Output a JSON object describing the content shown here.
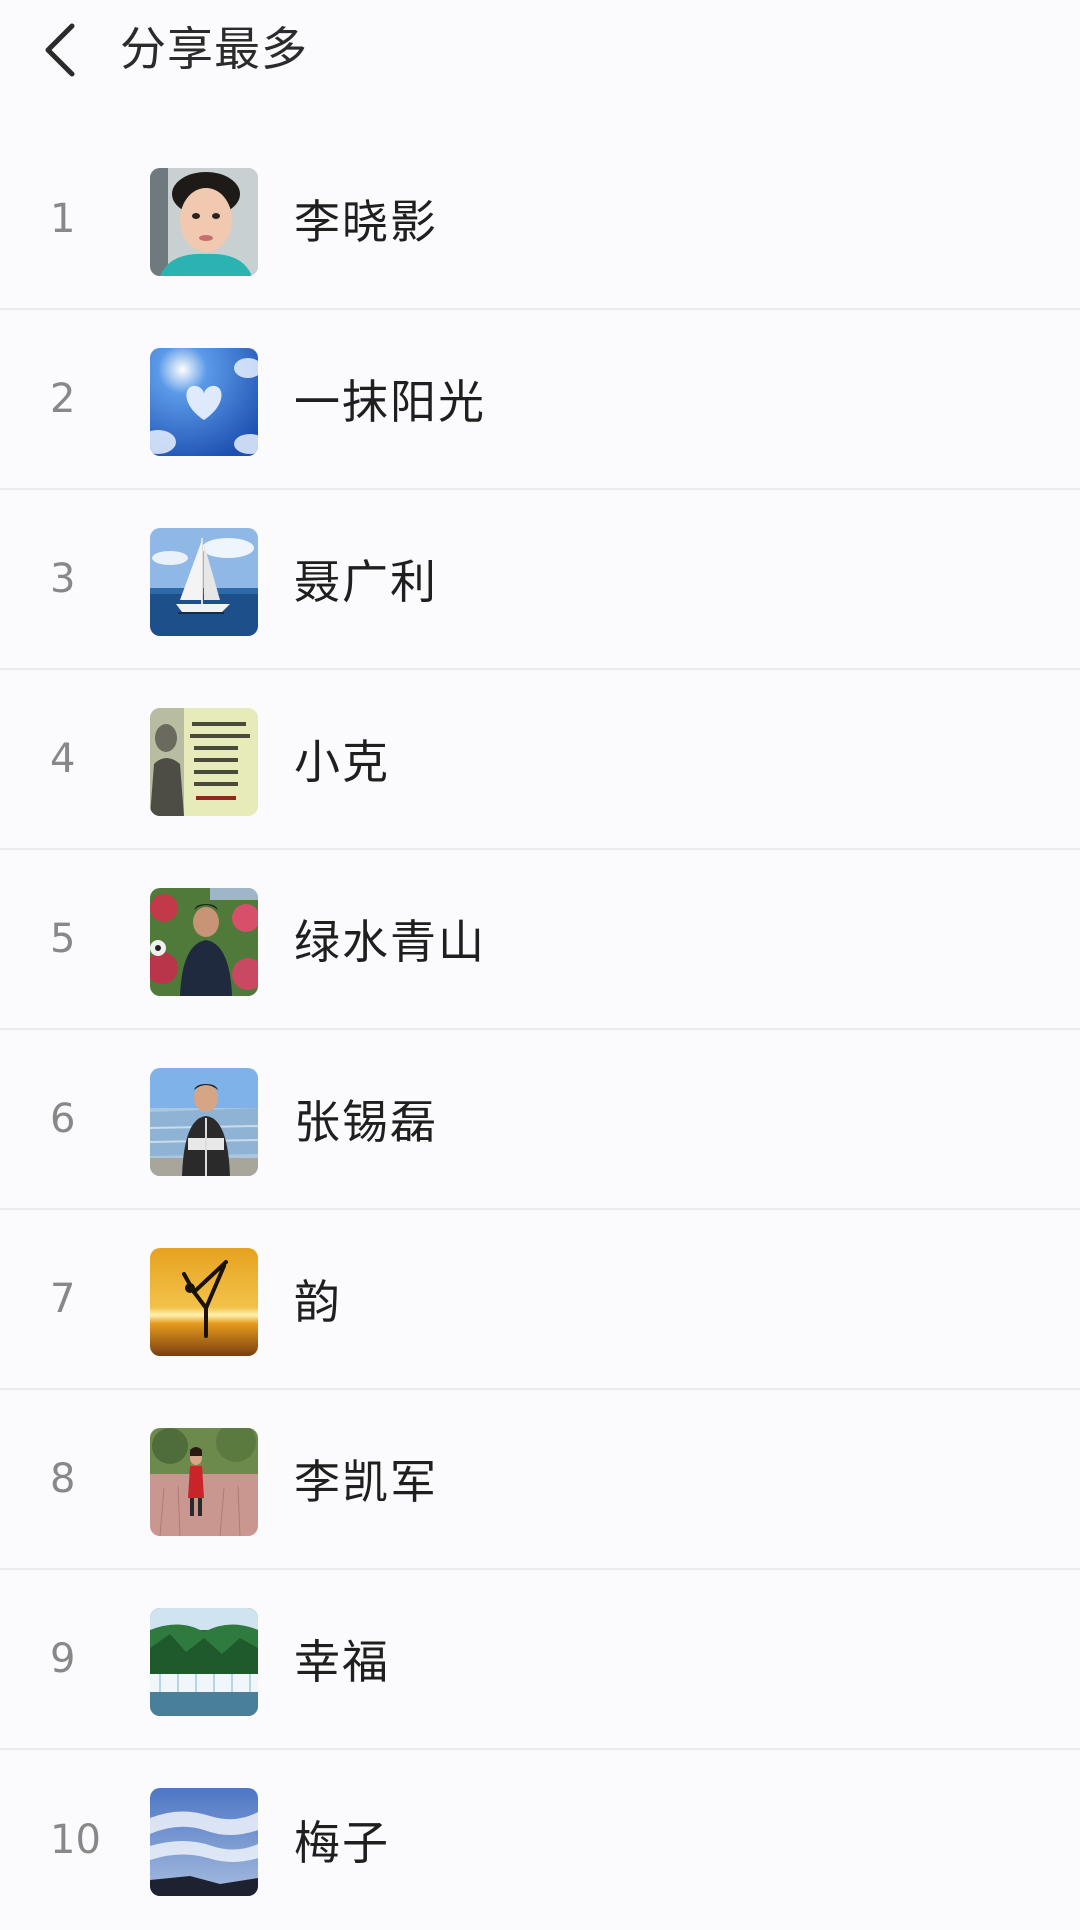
{
  "header": {
    "title": "分享最多",
    "back_icon": "chevron-left-icon"
  },
  "colors": {
    "background": "#fbfbfd",
    "divider": "#ececef",
    "rank_text": "#888888",
    "name_text": "#1f1f1f"
  },
  "ranking": [
    {
      "rank": "1",
      "name": "李晓影",
      "avatar": "portrait-woman-avatar"
    },
    {
      "rank": "2",
      "name": "一抹阳光",
      "avatar": "heart-cloud-sky-avatar"
    },
    {
      "rank": "3",
      "name": "聂广利",
      "avatar": "sailboat-avatar"
    },
    {
      "rank": "4",
      "name": "小克",
      "avatar": "text-poster-avatar"
    },
    {
      "rank": "5",
      "name": "绿水青山",
      "avatar": "man-in-garden-avatar"
    },
    {
      "rank": "6",
      "name": "张锡磊",
      "avatar": "man-at-stadium-avatar"
    },
    {
      "rank": "7",
      "name": "韵",
      "avatar": "sunset-dancer-avatar"
    },
    {
      "rank": "8",
      "name": "李凯军",
      "avatar": "woman-in-field-avatar"
    },
    {
      "rank": "9",
      "name": "幸福",
      "avatar": "waterfall-avatar"
    },
    {
      "rank": "10",
      "name": "梅子",
      "avatar": "cloud-sky-avatar"
    }
  ]
}
